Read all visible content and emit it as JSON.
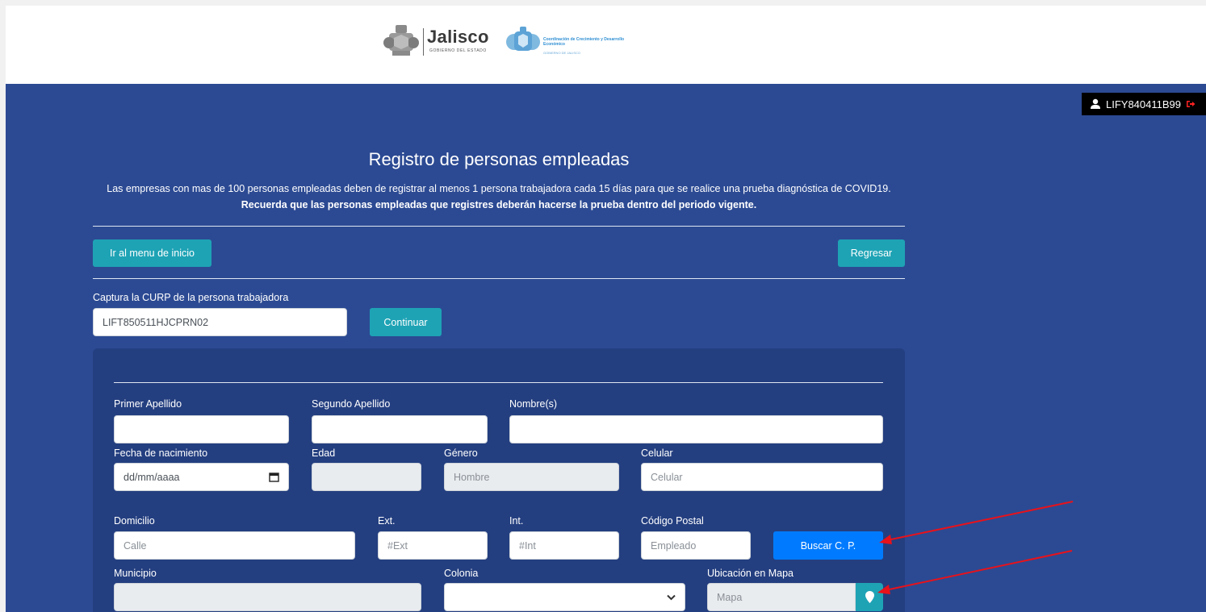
{
  "header": {
    "logo1_text": "Jalisco",
    "logo1_sub": "GOBIERNO DEL ESTADO",
    "logo2_text": "Coordinación de Crecimiento y Desarrollo Económico",
    "logo2_sub": "GOBIERNO DE JALISCO"
  },
  "user": {
    "id": "LIFY840411B99",
    "user_icon": "user-icon",
    "logout_icon": "logout-icon"
  },
  "page": {
    "title": "Registro de personas empleadas",
    "description_part1": "Las empresas con mas de 100 personas empleadas deben de registrar al menos 1 persona trabajadora cada 15 días para que se realice una prueba diagnóstica de COVID19. ",
    "description_bold": "Recuerda que las personas empleadas que registres deberán hacerse la prueba dentro del periodo vigente."
  },
  "nav": {
    "home_button": "Ir al menu de inicio",
    "back_button": "Regresar"
  },
  "curp": {
    "label": "Captura la CURP de la persona trabajadora",
    "value": "LIFT850511HJCPRN02",
    "continue_button": "Continuar"
  },
  "form": {
    "primer_apellido_label": "Primer Apellido",
    "segundo_apellido_label": "Segundo Apellido",
    "nombre_label": "Nombre(s)",
    "fecha_label": "Fecha de nacimiento",
    "fecha_placeholder": "dd/mm/aaaa",
    "edad_label": "Edad",
    "genero_label": "Género",
    "genero_value": "Hombre",
    "celular_label": "Celular",
    "celular_placeholder": "Celular",
    "domicilio_label": "Domicilio",
    "calle_placeholder": "Calle",
    "ext_label": "Ext.",
    "ext_placeholder": "#Ext",
    "int_label": "Int.",
    "int_placeholder": "#Int",
    "cp_label": "Código Postal",
    "cp_placeholder": "Empleado",
    "buscar_cp_button": "Buscar C. P.",
    "municipio_label": "Municipio",
    "colonia_label": "Colonia",
    "colonia_value": "",
    "mapa_label": "Ubicación en Mapa",
    "mapa_placeholder": "Mapa"
  },
  "colors": {
    "background": "#2c4a93",
    "panel": "#243f80",
    "teal_button": "#1ea3b5",
    "blue_button": "#007bff",
    "annotation_arrow": "#e8121b"
  }
}
